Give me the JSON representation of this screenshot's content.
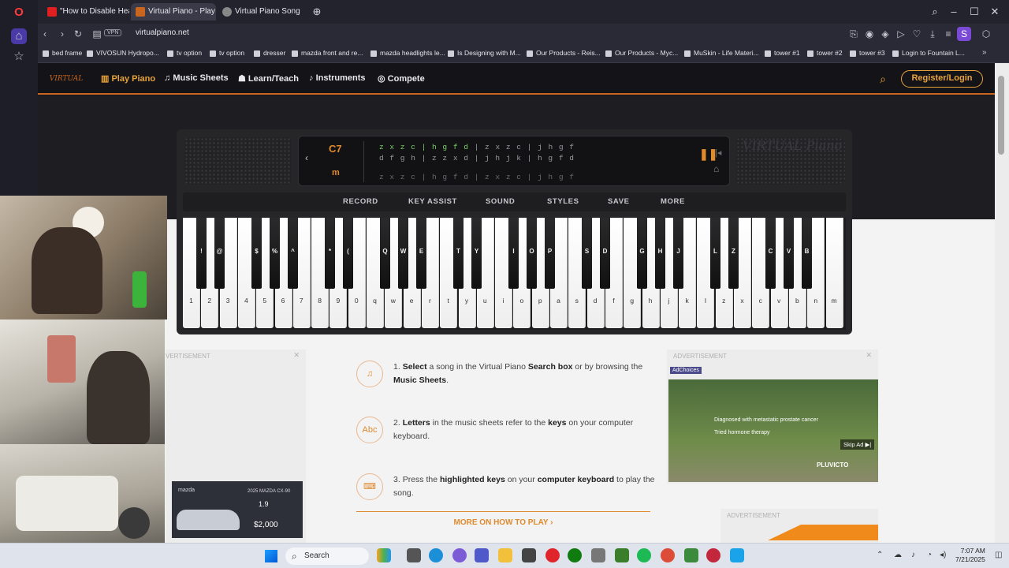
{
  "browser": {
    "tabs": [
      {
        "title": "\"How to Disable Heads-U"
      },
      {
        "title": "Virtual Piano - Play Th"
      },
      {
        "title": "Virtual Piano Song"
      }
    ],
    "url": "virtualpiano.net",
    "vpn_label": "VPN",
    "bookmarks": [
      "bed frame",
      "VIVOSUN Hydropo...",
      "tv option",
      "tv option",
      "dresser",
      "mazda front and re...",
      "mazda headlights le...",
      "Is Designing with M...",
      "Our Products - Reis...",
      "Our Products - Myc...",
      "MuSkin - Life Materi...",
      "tower #1",
      "tower #2",
      "tower #3",
      "Login to Fountain L..."
    ],
    "profile_letter": "S"
  },
  "site": {
    "logo": "VIRTUAL PIANO",
    "nav": [
      "Play Piano",
      "Music Sheets",
      "Learn/Teach",
      "Instruments",
      "Compete"
    ],
    "register": "Register/Login"
  },
  "piano": {
    "note": "C7",
    "mode": "m",
    "seq_line1a": "z x z c | ",
    "seq_line1b": "h g f d",
    "seq_line1c": " | z x z c | j h g f",
    "seq_line2": "d f g h | z z x d | j h j k | h g f d",
    "seq_line3": "z x z c | h g f d | z x z c | j h g f",
    "brand": "VIRTUAL Piano",
    "controls": [
      "RECORD",
      "KEY ASSIST",
      "SOUND",
      "STYLES",
      "SAVE",
      "MORE"
    ],
    "white_keys": [
      "1",
      "2",
      "3",
      "4",
      "5",
      "6",
      "7",
      "8",
      "9",
      "0",
      "q",
      "w",
      "e",
      "r",
      "t",
      "y",
      "u",
      "i",
      "o",
      "p",
      "a",
      "s",
      "d",
      "f",
      "g",
      "h",
      "j",
      "k",
      "l",
      "z",
      "x",
      "c",
      "v",
      "b",
      "n",
      "m"
    ],
    "black_keys": [
      "!",
      "@",
      "$",
      "%",
      "^",
      "*",
      "(",
      "Q",
      "W",
      "E",
      "T",
      "Y",
      "I",
      "O",
      "P",
      "S",
      "D",
      "G",
      "H",
      "J",
      "L",
      "Z",
      "C",
      "V",
      "B"
    ]
  },
  "ads": {
    "label": "ADVERTISEMENT",
    "label_left": "VERTISEMENT",
    "adchoices": "AdChoices",
    "line1": "Diagnosed with metastatic prostate cancer",
    "line2": "Tried hormone therapy",
    "skip": "Skip Ad ▶|",
    "brand": "PLUVICTO",
    "mazda_title": "2025 MAZDA CX-90",
    "mazda_rate": "1.9",
    "mazda_price": "$2,000",
    "mazda_logo": "mazda"
  },
  "instructions": {
    "step1_n": "1.",
    "step1_a": "Select",
    "step1_b": " a song in the Virtual Piano ",
    "step1_c": "Search box",
    "step1_d": " or by browsing the ",
    "step1_e": "Music Sheets",
    "step1_f": ".",
    "step2_n": "2.",
    "step2_a": "Letters",
    "step2_b": " in the music sheets refer to the ",
    "step2_c": "keys",
    "step2_d": " on your computer keyboard.",
    "step3_n": "3.",
    "step3_a": "Press the ",
    "step3_b": "highlighted keys",
    "step3_c": " on your ",
    "step3_d": "computer keyboard",
    "step3_e": " to play the song.",
    "more": "MORE ON HOW TO PLAY ›"
  },
  "taskbar": {
    "search": "Search",
    "time": "7:07 AM",
    "date": "7/21/2025"
  },
  "colors": {
    "accent": "#e08a2e",
    "highlight": "#7bd36a",
    "header_bg": "#141418"
  }
}
